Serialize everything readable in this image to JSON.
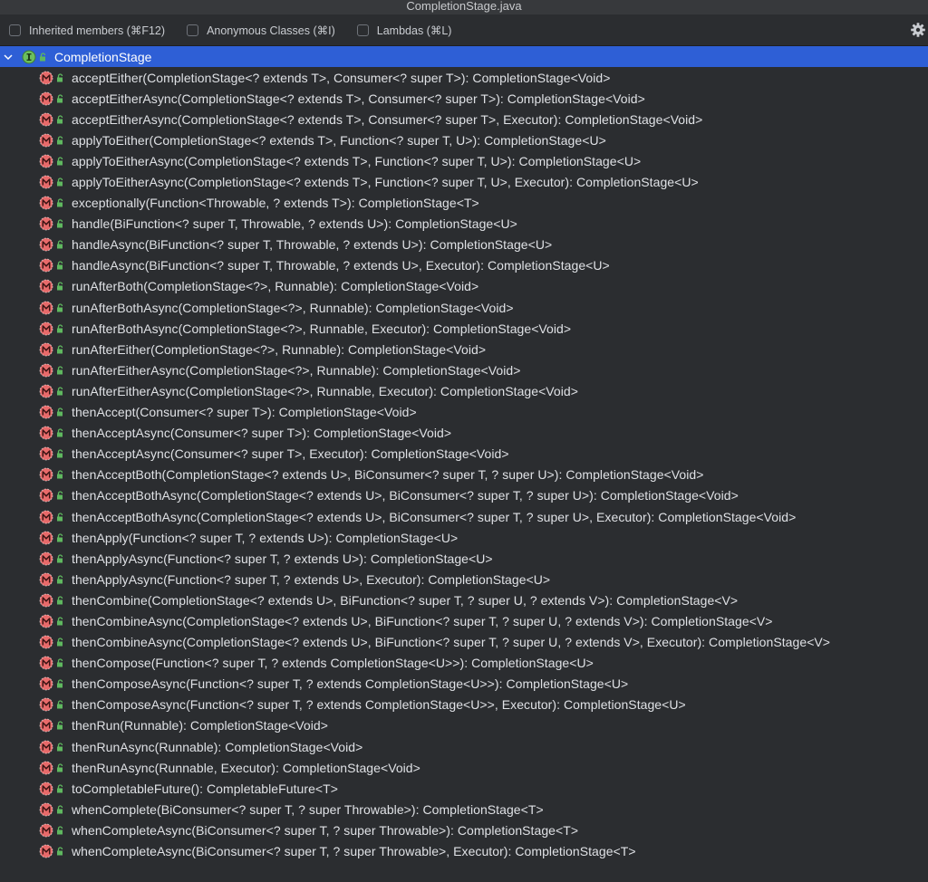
{
  "window": {
    "title": "CompletionStage.java"
  },
  "toolbar": {
    "options": [
      {
        "label": "Inherited members (⌘F12)",
        "checked": false
      },
      {
        "label": "Anonymous Classes (⌘I)",
        "checked": false
      },
      {
        "label": "Lambdas (⌘L)",
        "checked": false
      }
    ],
    "settings_icon": "gear-icon"
  },
  "tree": {
    "root": {
      "label": "CompletionStage",
      "icon": "interface-icon",
      "expanded": true,
      "selected": true
    },
    "methods": [
      "acceptEither(CompletionStage<? extends T>, Consumer<? super T>): CompletionStage<Void>",
      "acceptEitherAsync(CompletionStage<? extends T>, Consumer<? super T>): CompletionStage<Void>",
      "acceptEitherAsync(CompletionStage<? extends T>, Consumer<? super T>, Executor): CompletionStage<Void>",
      "applyToEither(CompletionStage<? extends T>, Function<? super T, U>): CompletionStage<U>",
      "applyToEitherAsync(CompletionStage<? extends T>, Function<? super T, U>): CompletionStage<U>",
      "applyToEitherAsync(CompletionStage<? extends T>, Function<? super T, U>, Executor): CompletionStage<U>",
      "exceptionally(Function<Throwable, ? extends T>): CompletionStage<T>",
      "handle(BiFunction<? super T, Throwable, ? extends U>): CompletionStage<U>",
      "handleAsync(BiFunction<? super T, Throwable, ? extends U>): CompletionStage<U>",
      "handleAsync(BiFunction<? super T, Throwable, ? extends U>, Executor): CompletionStage<U>",
      "runAfterBoth(CompletionStage<?>, Runnable): CompletionStage<Void>",
      "runAfterBothAsync(CompletionStage<?>, Runnable): CompletionStage<Void>",
      "runAfterBothAsync(CompletionStage<?>, Runnable, Executor): CompletionStage<Void>",
      "runAfterEither(CompletionStage<?>, Runnable): CompletionStage<Void>",
      "runAfterEitherAsync(CompletionStage<?>, Runnable): CompletionStage<Void>",
      "runAfterEitherAsync(CompletionStage<?>, Runnable, Executor): CompletionStage<Void>",
      "thenAccept(Consumer<? super T>): CompletionStage<Void>",
      "thenAcceptAsync(Consumer<? super T>): CompletionStage<Void>",
      "thenAcceptAsync(Consumer<? super T>, Executor): CompletionStage<Void>",
      "thenAcceptBoth(CompletionStage<? extends U>, BiConsumer<? super T, ? super U>): CompletionStage<Void>",
      "thenAcceptBothAsync(CompletionStage<? extends U>, BiConsumer<? super T, ? super U>): CompletionStage<Void>",
      "thenAcceptBothAsync(CompletionStage<? extends U>, BiConsumer<? super T, ? super U>, Executor): CompletionStage<Void>",
      "thenApply(Function<? super T, ? extends U>): CompletionStage<U>",
      "thenApplyAsync(Function<? super T, ? extends U>): CompletionStage<U>",
      "thenApplyAsync(Function<? super T, ? extends U>, Executor): CompletionStage<U>",
      "thenCombine(CompletionStage<? extends U>, BiFunction<? super T, ? super U, ? extends V>): CompletionStage<V>",
      "thenCombineAsync(CompletionStage<? extends U>, BiFunction<? super T, ? super U, ? extends V>): CompletionStage<V>",
      "thenCombineAsync(CompletionStage<? extends U>, BiFunction<? super T, ? super U, ? extends V>, Executor): CompletionStage<V>",
      "thenCompose(Function<? super T, ? extends CompletionStage<U>>): CompletionStage<U>",
      "thenComposeAsync(Function<? super T, ? extends CompletionStage<U>>): CompletionStage<U>",
      "thenComposeAsync(Function<? super T, ? extends CompletionStage<U>>, Executor): CompletionStage<U>",
      "thenRun(Runnable): CompletionStage<Void>",
      "thenRunAsync(Runnable): CompletionStage<Void>",
      "thenRunAsync(Runnable, Executor): CompletionStage<Void>",
      "toCompletableFuture(): CompletableFuture<T>",
      "whenComplete(BiConsumer<? super T, ? super Throwable>): CompletionStage<T>",
      "whenCompleteAsync(BiConsumer<? super T, ? super Throwable>): CompletionStage<T>",
      "whenCompleteAsync(BiConsumer<? super T, ? super Throwable>, Executor): CompletionStage<T>"
    ],
    "method_icon": "abstract-method-icon",
    "visibility_icon": "public-lock-icon"
  },
  "colors": {
    "background": "#2b2d30",
    "selection": "#2e5fd6",
    "method_icon": "#e86a6a",
    "lock_icon": "#5fb85f",
    "interface_icon": "#6cbf5e"
  }
}
